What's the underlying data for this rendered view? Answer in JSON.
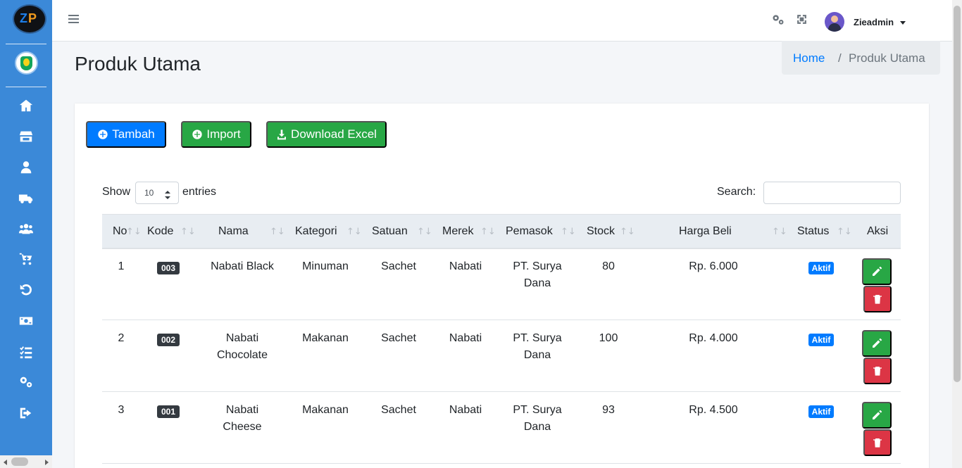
{
  "app": {
    "logo_text": "ZP",
    "seal_name": "regional-seal"
  },
  "topbar": {
    "username": "Zieadmin"
  },
  "page": {
    "title": "Produk Utama",
    "breadcrumb_home": "Home",
    "breadcrumb_sep": "/",
    "breadcrumb_current": "Produk Utama"
  },
  "toolbar": {
    "tambah": "Tambah",
    "import": "Import",
    "download_excel": "Download Excel"
  },
  "table_controls": {
    "show_label": "Show",
    "entries_value": "10",
    "entries_label": "entries",
    "search_label": "Search:"
  },
  "table": {
    "headers": [
      "No",
      "Kode",
      "Nama",
      "Kategori",
      "Satuan",
      "Merek",
      "Pemasok",
      "Stock",
      "Harga Beli",
      "Status",
      "Aksi"
    ],
    "rows": [
      {
        "no": "1",
        "kode": "003",
        "nama": "Nabati Black",
        "kategori": "Minuman",
        "satuan": "Sachet",
        "merek": "Nabati",
        "pemasok": "PT. Surya Dana",
        "stock": "80",
        "harga": "Rp. 6.000",
        "status": "Aktif"
      },
      {
        "no": "2",
        "kode": "002",
        "nama": "Nabati Chocolate",
        "kategori": "Makanan",
        "satuan": "Sachet",
        "merek": "Nabati",
        "pemasok": "PT. Surya Dana",
        "stock": "100",
        "harga": "Rp. 4.000",
        "status": "Aktif"
      },
      {
        "no": "3",
        "kode": "001",
        "nama": "Nabati Cheese",
        "kategori": "Makanan",
        "satuan": "Sachet",
        "merek": "Nabati",
        "pemasok": "PT. Surya Dana",
        "stock": "93",
        "harga": "Rp. 4.500",
        "status": "Aktif"
      }
    ]
  },
  "icons": {
    "sidebar": [
      "home-icon",
      "store-icon",
      "user-icon",
      "truck-icon",
      "users-icon",
      "cart-icon",
      "undo-icon",
      "money-icon",
      "tasks-icon",
      "settings-icon",
      "logout-icon"
    ],
    "top": [
      "gears-icon",
      "expand-icon",
      "user-menu-caret-icon"
    ]
  },
  "colors": {
    "sidebar": "#3b89d8",
    "primary": "#007bff",
    "success": "#28a745",
    "danger": "#dc3545",
    "dark": "#343a40"
  }
}
